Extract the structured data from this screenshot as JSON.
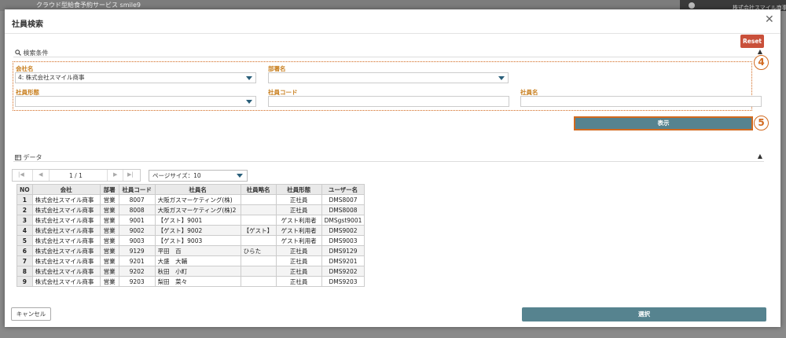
{
  "background": {
    "app_title": "クラウド型給食予約サービス smile9",
    "company": "株式会社スマイル商事"
  },
  "dialog": {
    "title": "社員検索",
    "close": "✕",
    "reset_label": "Reset"
  },
  "search": {
    "section_label": "検索条件",
    "company_label": "会社名",
    "company_value": "4: 株式会社スマイル商事",
    "department_label": "部署名",
    "department_value": "",
    "employment_type_label": "社員形態",
    "employment_type_value": "",
    "employee_code_label": "社員コード",
    "employee_code_value": "",
    "employee_name_label": "社員名",
    "employee_name_value": "",
    "show_label": "表示",
    "badge_4": "4",
    "badge_5": "5"
  },
  "data_section": {
    "label": "データ",
    "pager_text": "1 / 1",
    "page_size_label": "ページサイズ：10",
    "columns": [
      "NO",
      "会社",
      "部署",
      "社員コード",
      "社員名",
      "社員略名",
      "社員形態",
      "ユーザー名"
    ],
    "rows": [
      [
        "1",
        "株式会社スマイル商事",
        "営業",
        "8007",
        "大阪ガスマーケティング(株)",
        "",
        "正社員",
        "DMS8007"
      ],
      [
        "2",
        "株式会社スマイル商事",
        "営業",
        "8008",
        "大阪ガスマーケティング(株)2",
        "",
        "正社員",
        "DMS8008"
      ],
      [
        "3",
        "株式会社スマイル商事",
        "営業",
        "9001",
        "【ゲスト】9001",
        "",
        "ゲスト利用者",
        "DMSgst9001"
      ],
      [
        "4",
        "株式会社スマイル商事",
        "営業",
        "9002",
        "【ゲスト】9002",
        "【ゲスト】",
        "ゲスト利用者",
        "DMS9002"
      ],
      [
        "5",
        "株式会社スマイル商事",
        "営業",
        "9003",
        "【ゲスト】9003",
        "",
        "ゲスト利用者",
        "DMS9003"
      ],
      [
        "6",
        "株式会社スマイル商事",
        "営業",
        "9129",
        "平田　百",
        "ひらた",
        "正社員",
        "DMS9129"
      ],
      [
        "7",
        "株式会社スマイル商事",
        "営業",
        "9201",
        "大盛　大輔",
        "",
        "正社員",
        "DMS9201"
      ],
      [
        "8",
        "株式会社スマイル商事",
        "営業",
        "9202",
        "秋田　小町",
        "",
        "正社員",
        "DMS9202"
      ],
      [
        "9",
        "株式会社スマイル商事",
        "営業",
        "9203",
        "梨田　菜々",
        "",
        "正社員",
        "DMS9203"
      ]
    ]
  },
  "footer": {
    "cancel_label": "キャンセル",
    "select_label": "選択"
  },
  "colors": {
    "label_orange": "#c87e1d",
    "annotation_orange": "#d2691e",
    "button_teal": "#56838f",
    "reset_red": "#c9503a"
  }
}
